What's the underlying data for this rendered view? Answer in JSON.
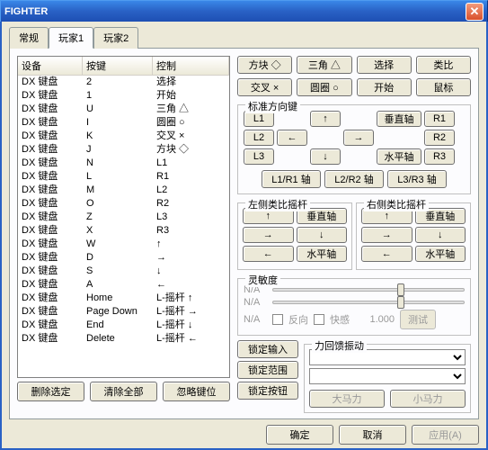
{
  "title": "FIGHTER",
  "tabs": [
    "常规",
    "玩家1",
    "玩家2"
  ],
  "active_tab": 1,
  "headers": [
    "设备",
    "按键",
    "控制"
  ],
  "rows": [
    [
      "DX 键盘",
      "2",
      "选择"
    ],
    [
      "DX 键盘",
      "1",
      "开始"
    ],
    [
      "DX 键盘",
      "U",
      "三角 △"
    ],
    [
      "DX 键盘",
      "I",
      "圆圈 ○"
    ],
    [
      "DX 键盘",
      "K",
      "交叉 ×"
    ],
    [
      "DX 键盘",
      "J",
      "方块 ◇"
    ],
    [
      "DX 键盘",
      "N",
      "L1"
    ],
    [
      "DX 键盘",
      "L",
      "R1"
    ],
    [
      "DX 键盘",
      "M",
      "L2"
    ],
    [
      "DX 键盘",
      "O",
      "R2"
    ],
    [
      "DX 键盘",
      "Z",
      "L3"
    ],
    [
      "DX 键盘",
      "X",
      "R3"
    ],
    [
      "DX 键盘",
      "W",
      "↑"
    ],
    [
      "DX 键盘",
      "D",
      "→"
    ],
    [
      "DX 键盘",
      "S",
      "↓"
    ],
    [
      "DX 键盘",
      "A",
      "←"
    ],
    [
      "DX 键盘",
      "Home",
      "L-摇杆 ↑"
    ],
    [
      "DX 键盘",
      "Page Down",
      "L-摇杆 →"
    ],
    [
      "DX 键盘",
      "End",
      "L-摇杆 ↓"
    ],
    [
      "DX 键盘",
      "Delete",
      "L-摇杆 ←"
    ]
  ],
  "left_buttons": {
    "delete": "删除选定",
    "clear": "清除全部",
    "ignore": "忽略键位"
  },
  "face": {
    "square": "方块 ◇",
    "triangle": "三角 △",
    "select": "选择",
    "analog": "类比",
    "cross": "交叉 ×",
    "circle": "圆圈 ○",
    "start": "开始",
    "mouse": "鼠标"
  },
  "dpad_label": "标准方向键",
  "shoulder": {
    "l1": "L1",
    "l2": "L2",
    "l3": "L3",
    "r1": "R1",
    "r2": "R2",
    "r3": "R3"
  },
  "arrows": {
    "up": "↑",
    "down": "↓",
    "left": "←",
    "right": "→"
  },
  "axis": {
    "vert": "垂直轴",
    "horiz": "水平轴"
  },
  "axis_buttons": {
    "l1r1": "L1/R1 轴",
    "l2r2": "L2/R2 轴",
    "l3r3": "L3/R3 轴"
  },
  "stick_left": "左侧类比摇杆",
  "stick_right": "右侧类比摇杆",
  "sens_label": "灵敏度",
  "na": "N/A",
  "checks": {
    "invert": "反向",
    "quick": "快感"
  },
  "sens_val": "1.000",
  "test": "测试",
  "lock": {
    "input": "锁定输入",
    "range": "锁定范围",
    "button": "锁定按钮"
  },
  "ff_label": "力回馈振动",
  "ff": {
    "big": "大马力",
    "small": "小马力"
  },
  "dlg": {
    "ok": "确定",
    "cancel": "取消",
    "apply": "应用(A)"
  }
}
